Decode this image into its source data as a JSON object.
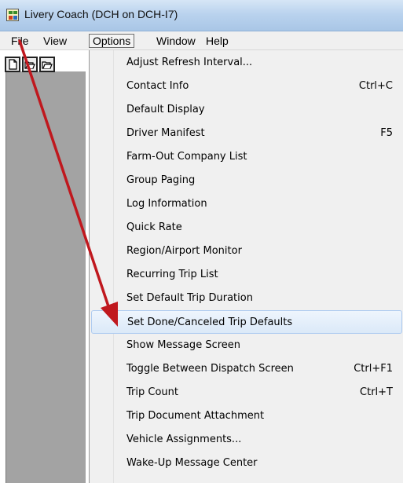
{
  "window": {
    "title": "Livery Coach (DCH on DCH-I7)",
    "app_icon": "livery-coach-app-icon"
  },
  "menubar": {
    "items": [
      {
        "label": "File"
      },
      {
        "label": "View"
      },
      {
        "label": "Options",
        "active": true
      },
      {
        "label": "Window"
      },
      {
        "label": "Help"
      }
    ]
  },
  "toolbar": {
    "icons": [
      "new-document-icon",
      "open-folder-icon",
      "open-folder-icon"
    ]
  },
  "options_menu": {
    "highlighted_index": 11,
    "items": [
      {
        "label": "Adjust Refresh Interval...",
        "shortcut": ""
      },
      {
        "label": "Contact Info",
        "shortcut": "Ctrl+C"
      },
      {
        "label": "Default Display",
        "shortcut": ""
      },
      {
        "label": "Driver Manifest",
        "shortcut": "F5"
      },
      {
        "label": "Farm-Out Company List",
        "shortcut": ""
      },
      {
        "label": "Group Paging",
        "shortcut": ""
      },
      {
        "label": "Log Information",
        "shortcut": ""
      },
      {
        "label": "Quick Rate",
        "shortcut": ""
      },
      {
        "label": "Region/Airport Monitor",
        "shortcut": ""
      },
      {
        "label": "Recurring Trip List",
        "shortcut": ""
      },
      {
        "label": "Set Default Trip Duration",
        "shortcut": ""
      },
      {
        "label": "Set Done/Canceled Trip Defaults",
        "shortcut": ""
      },
      {
        "label": "Show Message Screen",
        "shortcut": ""
      },
      {
        "label": "Toggle Between Dispatch Screen",
        "shortcut": "Ctrl+F1"
      },
      {
        "label": "Trip Count",
        "shortcut": "Ctrl+T"
      },
      {
        "label": "Trip Document Attachment",
        "shortcut": ""
      },
      {
        "label": "Vehicle Assignments...",
        "shortcut": ""
      },
      {
        "label": "Wake-Up Message Center",
        "shortcut": ""
      }
    ]
  },
  "annotation": {
    "color": "#c0181e"
  }
}
